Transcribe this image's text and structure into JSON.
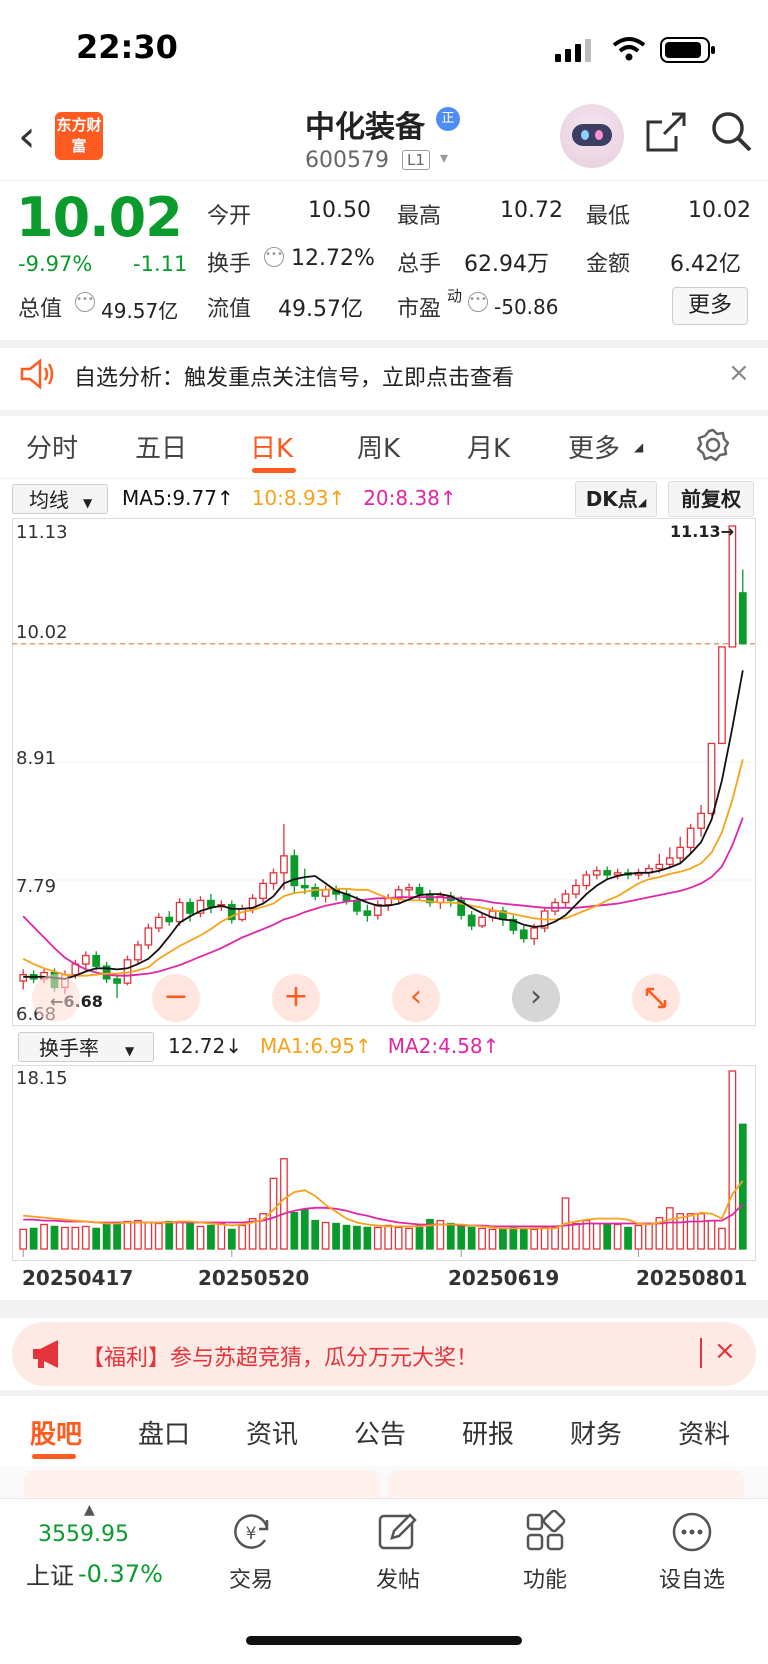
{
  "status_bar": {
    "time": "22:30"
  },
  "header": {
    "logo_text": "东方财富",
    "title": "中化装备",
    "badge": "正",
    "code": "600579",
    "level": "L1"
  },
  "quote": {
    "price": "10.02",
    "change_pct": "-9.97%",
    "change": "-1.11",
    "open_label": "今开",
    "open": "10.50",
    "high_label": "最高",
    "high": "10.72",
    "low_label": "最低",
    "low": "10.02",
    "turnover_label": "换手",
    "turnover": "12.72%",
    "volume_label": "总手",
    "volume": "62.94万",
    "amount_label": "金额",
    "amount": "6.42亿",
    "mktcap_label": "总值",
    "mktcap": "49.57亿",
    "float_label": "流值",
    "float": "49.57亿",
    "pe_label": "市盈",
    "pe_sup": "动",
    "pe": "-50.86",
    "more_label": "更多"
  },
  "analysis_banner": {
    "text": "自选分析：触发重点关注信号，立即点击查看",
    "close": "×"
  },
  "tabs": [
    "分时",
    "五日",
    "日K",
    "周K",
    "月K",
    "更多"
  ],
  "active_tab": "日K",
  "ma_bar": {
    "select": "均线",
    "ma5": "MA5:9.77↑",
    "ma10": "10:8.93↑",
    "ma20": "20:8.38↑",
    "dk": "DK点",
    "adjust": "前复权"
  },
  "turnover_bar": {
    "select": "换手率",
    "value": "12.72↓",
    "ma1": "MA1:6.95↑",
    "ma2": "MA2:4.58↑"
  },
  "colors": {
    "up": "#e4333a",
    "down": "#0a9b2c",
    "ma5": "#111111",
    "ma10": "#f7a21b",
    "ma20": "#e026a6",
    "accent": "#ff5a1f"
  },
  "chart_data": [
    {
      "type": "candlestick",
      "y_ticks": [
        "11.13",
        "10.02",
        "8.91",
        "7.79",
        "6.68"
      ],
      "ylim": [
        6.68,
        11.13
      ],
      "annotations": {
        "max": "11.13→",
        "min": "←6.68"
      },
      "current_line": 10.02,
      "candles": [
        [
          6.84,
          6.9,
          6.76,
          6.95
        ],
        [
          6.9,
          6.86,
          6.82,
          6.94
        ],
        [
          6.86,
          6.92,
          6.82,
          6.96
        ],
        [
          6.92,
          6.78,
          6.74,
          6.96
        ],
        [
          6.78,
          6.9,
          6.72,
          6.94
        ],
        [
          6.9,
          7.0,
          6.86,
          7.04
        ],
        [
          7.0,
          7.08,
          6.94,
          7.12
        ],
        [
          7.08,
          6.98,
          6.94,
          7.12
        ],
        [
          6.98,
          6.86,
          6.82,
          7.02
        ],
        [
          6.86,
          6.82,
          6.68,
          6.9
        ],
        [
          6.82,
          7.04,
          6.8,
          7.08
        ],
        [
          7.04,
          7.18,
          7.0,
          7.22
        ],
        [
          7.18,
          7.34,
          7.14,
          7.38
        ],
        [
          7.34,
          7.44,
          7.3,
          7.48
        ],
        [
          7.44,
          7.4,
          7.36,
          7.5
        ],
        [
          7.4,
          7.58,
          7.36,
          7.62
        ],
        [
          7.58,
          7.48,
          7.4,
          7.62
        ],
        [
          7.48,
          7.6,
          7.44,
          7.64
        ],
        [
          7.6,
          7.54,
          7.48,
          7.66
        ],
        [
          7.54,
          7.56,
          7.5,
          7.6
        ],
        [
          7.56,
          7.42,
          7.38,
          7.6
        ],
        [
          7.42,
          7.52,
          7.4,
          7.56
        ],
        [
          7.52,
          7.62,
          7.48,
          7.66
        ],
        [
          7.62,
          7.76,
          7.58,
          7.8
        ],
        [
          7.76,
          7.86,
          7.7,
          7.9
        ],
        [
          7.86,
          8.02,
          7.7,
          8.32
        ],
        [
          8.02,
          7.74,
          7.66,
          8.08
        ],
        [
          7.74,
          7.72,
          7.66,
          7.9
        ],
        [
          7.72,
          7.64,
          7.6,
          7.76
        ],
        [
          7.64,
          7.7,
          7.58,
          7.74
        ],
        [
          7.7,
          7.66,
          7.6,
          7.74
        ],
        [
          7.66,
          7.6,
          7.56,
          7.7
        ],
        [
          7.6,
          7.5,
          7.46,
          7.64
        ],
        [
          7.5,
          7.46,
          7.4,
          7.56
        ],
        [
          7.46,
          7.56,
          7.42,
          7.6
        ],
        [
          7.56,
          7.62,
          7.5,
          7.66
        ],
        [
          7.62,
          7.7,
          7.56,
          7.74
        ],
        [
          7.7,
          7.72,
          7.64,
          7.76
        ],
        [
          7.72,
          7.66,
          7.6,
          7.76
        ],
        [
          7.66,
          7.58,
          7.54,
          7.7
        ],
        [
          7.58,
          7.64,
          7.52,
          7.68
        ],
        [
          7.64,
          7.6,
          7.54,
          7.68
        ],
        [
          7.6,
          7.46,
          7.42,
          7.64
        ],
        [
          7.46,
          7.36,
          7.32,
          7.5
        ],
        [
          7.36,
          7.44,
          7.34,
          7.48
        ],
        [
          7.44,
          7.5,
          7.4,
          7.54
        ],
        [
          7.5,
          7.42,
          7.36,
          7.54
        ],
        [
          7.42,
          7.32,
          7.28,
          7.46
        ],
        [
          7.32,
          7.24,
          7.2,
          7.36
        ],
        [
          7.24,
          7.34,
          7.18,
          7.38
        ],
        [
          7.34,
          7.5,
          7.3,
          7.54
        ],
        [
          7.5,
          7.58,
          7.46,
          7.62
        ],
        [
          7.58,
          7.66,
          7.54,
          7.7
        ],
        [
          7.66,
          7.74,
          7.62,
          7.8
        ],
        [
          7.74,
          7.84,
          7.7,
          7.88
        ],
        [
          7.84,
          7.88,
          7.8,
          7.92
        ],
        [
          7.88,
          7.84,
          7.8,
          7.92
        ],
        [
          7.84,
          7.86,
          7.8,
          7.9
        ],
        [
          7.86,
          7.84,
          7.8,
          7.9
        ],
        [
          7.84,
          7.86,
          7.8,
          7.9
        ],
        [
          7.86,
          7.9,
          7.82,
          7.94
        ],
        [
          7.9,
          7.94,
          7.86,
          8.04
        ],
        [
          7.94,
          8.0,
          7.9,
          8.1
        ],
        [
          8.0,
          8.1,
          7.94,
          8.2
        ],
        [
          8.1,
          8.28,
          8.04,
          8.32
        ],
        [
          8.28,
          8.42,
          8.2,
          8.5
        ],
        [
          8.42,
          9.08,
          8.4,
          9.08
        ],
        [
          9.08,
          9.99,
          9.08,
          9.99
        ],
        [
          9.99,
          11.13,
          10.0,
          11.13
        ],
        [
          10.5,
          10.02,
          10.02,
          10.72
        ]
      ],
      "ma5": [
        6.88,
        6.88,
        6.88,
        6.87,
        6.86,
        6.89,
        6.93,
        6.96,
        6.96,
        6.95,
        6.96,
        7.0,
        7.05,
        7.14,
        7.26,
        7.39,
        7.45,
        7.5,
        7.53,
        7.55,
        7.52,
        7.52,
        7.53,
        7.57,
        7.64,
        7.76,
        7.8,
        7.82,
        7.83,
        7.76,
        7.69,
        7.66,
        7.62,
        7.58,
        7.55,
        7.55,
        7.57,
        7.61,
        7.65,
        7.66,
        7.66,
        7.64,
        7.59,
        7.53,
        7.48,
        7.44,
        7.42,
        7.41,
        7.37,
        7.35,
        7.36,
        7.4,
        7.46,
        7.56,
        7.66,
        7.74,
        7.8,
        7.83,
        7.85,
        7.86,
        7.86,
        7.88,
        7.91,
        7.95,
        8.04,
        8.15,
        8.36,
        8.73,
        9.23,
        9.77
      ],
      "ma10": [
        7.05,
        7.0,
        6.96,
        6.93,
        6.9,
        6.89,
        6.89,
        6.9,
        6.91,
        6.91,
        6.92,
        6.94,
        6.97,
        7.05,
        7.11,
        7.17,
        7.22,
        7.27,
        7.33,
        7.4,
        7.45,
        7.49,
        7.51,
        7.54,
        7.57,
        7.64,
        7.67,
        7.68,
        7.7,
        7.7,
        7.71,
        7.71,
        7.7,
        7.7,
        7.66,
        7.62,
        7.61,
        7.6,
        7.6,
        7.59,
        7.58,
        7.58,
        7.57,
        7.55,
        7.53,
        7.51,
        7.49,
        7.47,
        7.45,
        7.43,
        7.42,
        7.42,
        7.43,
        7.47,
        7.51,
        7.55,
        7.6,
        7.64,
        7.7,
        7.76,
        7.8,
        7.82,
        7.85,
        7.87,
        7.9,
        7.95,
        8.05,
        8.24,
        8.55,
        8.93
      ],
      "ma20": [
        7.45,
        7.35,
        7.25,
        7.15,
        7.06,
        7.0,
        6.95,
        6.92,
        6.9,
        6.89,
        6.89,
        6.9,
        6.91,
        6.93,
        6.96,
        6.99,
        7.03,
        7.07,
        7.11,
        7.15,
        7.2,
        7.25,
        7.29,
        7.33,
        7.37,
        7.42,
        7.45,
        7.49,
        7.52,
        7.55,
        7.57,
        7.59,
        7.6,
        7.61,
        7.62,
        7.62,
        7.63,
        7.63,
        7.63,
        7.63,
        7.63,
        7.62,
        7.62,
        7.61,
        7.6,
        7.58,
        7.57,
        7.56,
        7.55,
        7.54,
        7.53,
        7.53,
        7.53,
        7.53,
        7.54,
        7.55,
        7.56,
        7.57,
        7.59,
        7.61,
        7.63,
        7.65,
        7.67,
        7.69,
        7.72,
        7.76,
        7.82,
        7.92,
        8.12,
        8.38
      ]
    },
    {
      "type": "bar",
      "y_ticks": [
        "18.15"
      ],
      "ylim": [
        0,
        18.15
      ],
      "categories_shown": [
        "20250417",
        "20250520",
        "20250619",
        "20250801"
      ],
      "category_index": [
        0,
        20,
        42,
        59
      ],
      "values": [
        2.0,
        2.1,
        2.5,
        2.3,
        2.2,
        2.2,
        2.3,
        2.1,
        2.6,
        2.7,
        2.8,
        2.9,
        2.7,
        2.6,
        2.8,
        2.8,
        2.7,
        2.3,
        2.4,
        2.6,
        2.0,
        2.4,
        3.1,
        3.6,
        7.2,
        9.2,
        3.7,
        4.0,
        2.9,
        2.7,
        2.6,
        2.4,
        2.3,
        2.2,
        2.2,
        2.4,
        2.2,
        2.1,
        2.4,
        3.0,
        2.9,
        2.6,
        2.3,
        2.2,
        2.1,
        2.0,
        2.1,
        2.2,
        2.0,
        2.0,
        2.2,
        2.2,
        5.2,
        2.6,
        2.9,
        2.6,
        2.5,
        2.5,
        2.2,
        2.4,
        2.6,
        3.2,
        4.2,
        3.6,
        3.6,
        3.6,
        2.9,
        2.1,
        18.15,
        12.72
      ],
      "ma1": [
        3.4,
        3.3,
        3.2,
        3.1,
        3.0,
        2.9,
        2.8,
        2.7,
        2.6,
        2.6,
        2.7,
        2.7,
        2.7,
        2.7,
        2.7,
        2.8,
        2.8,
        2.7,
        2.6,
        2.5,
        2.4,
        2.5,
        2.7,
        3.0,
        4.0,
        5.1,
        5.8,
        6.0,
        5.4,
        4.5,
        3.8,
        3.1,
        2.7,
        2.5,
        2.4,
        2.3,
        2.3,
        2.3,
        2.3,
        2.4,
        2.5,
        2.5,
        2.5,
        2.4,
        2.3,
        2.2,
        2.1,
        2.1,
        2.1,
        2.1,
        2.1,
        2.1,
        2.6,
        2.8,
        3.0,
        3.1,
        3.1,
        3.1,
        3.0,
        2.6,
        2.5,
        2.7,
        3.0,
        3.2,
        3.4,
        3.7,
        3.6,
        3.1,
        5.6,
        6.95
      ],
      "ma2": [
        3.0,
        3.0,
        2.9,
        2.9,
        2.8,
        2.8,
        2.8,
        2.7,
        2.7,
        2.7,
        2.7,
        2.7,
        2.7,
        2.7,
        2.7,
        2.7,
        2.7,
        2.7,
        2.7,
        2.7,
        2.7,
        2.7,
        2.8,
        2.9,
        3.2,
        3.6,
        3.9,
        4.1,
        4.2,
        4.2,
        4.1,
        3.9,
        3.6,
        3.4,
        3.1,
        2.9,
        2.7,
        2.6,
        2.5,
        2.5,
        2.5,
        2.5,
        2.4,
        2.4,
        2.4,
        2.3,
        2.3,
        2.3,
        2.3,
        2.3,
        2.3,
        2.3,
        2.4,
        2.5,
        2.6,
        2.6,
        2.6,
        2.6,
        2.6,
        2.6,
        2.6,
        2.6,
        2.7,
        2.7,
        2.8,
        2.8,
        2.9,
        2.9,
        3.5,
        4.58
      ]
    }
  ],
  "promo": {
    "text": "【福利】参与苏超竞猜，瓜分万元大奖！",
    "close": "×"
  },
  "bottom_tabs": [
    "股吧",
    "盘口",
    "资讯",
    "公告",
    "研报",
    "财务",
    "资料"
  ],
  "active_bottom_tab": "股吧",
  "bottom_bar": {
    "index_value": "3559.95",
    "index_name": "上证",
    "index_change": "-0.37%",
    "items": [
      "交易",
      "发帖",
      "功能",
      "设自选"
    ]
  }
}
